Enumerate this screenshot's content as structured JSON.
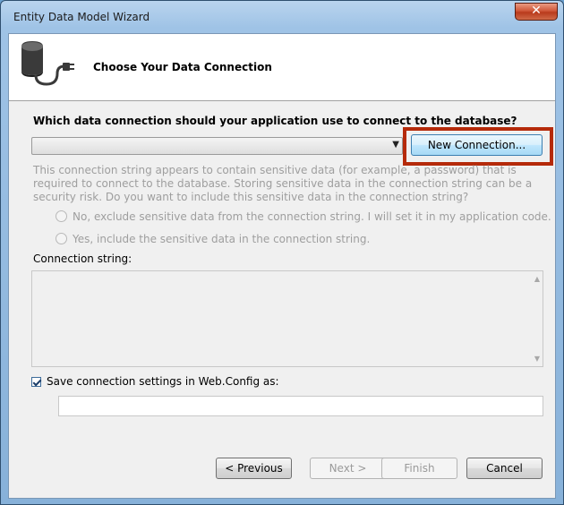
{
  "window": {
    "title": "Entity Data Model Wizard",
    "close_label": "✕"
  },
  "header": {
    "title": "Choose Your Data Connection",
    "icon": "database-connection-icon"
  },
  "connection": {
    "question": "Which data connection should your application use to connect to the database?",
    "selected_value": "",
    "new_connection_label": "New Connection...",
    "sensitive_notice": "This connection string appears to contain sensitive data (for example, a password) that is required to connect to the database. Storing sensitive data in the connection string can be a security risk. Do you want to include this sensitive data in the connection string?",
    "option_exclude": "No, exclude sensitive data from the connection string. I will set it in my application code.",
    "option_include": "Yes, include the sensitive data in the connection string.",
    "string_label": "Connection string:",
    "string_value": ""
  },
  "config": {
    "save_label": "Save connection settings in Web.Config as:",
    "checked": true,
    "value": ""
  },
  "footer": {
    "previous_label": "< Previous",
    "next_label": "Next >",
    "finish_label": "Finish",
    "cancel_label": "Cancel"
  },
  "colors": {
    "highlight": "#b52a0a",
    "disabled_text": "#9e9e9e"
  }
}
